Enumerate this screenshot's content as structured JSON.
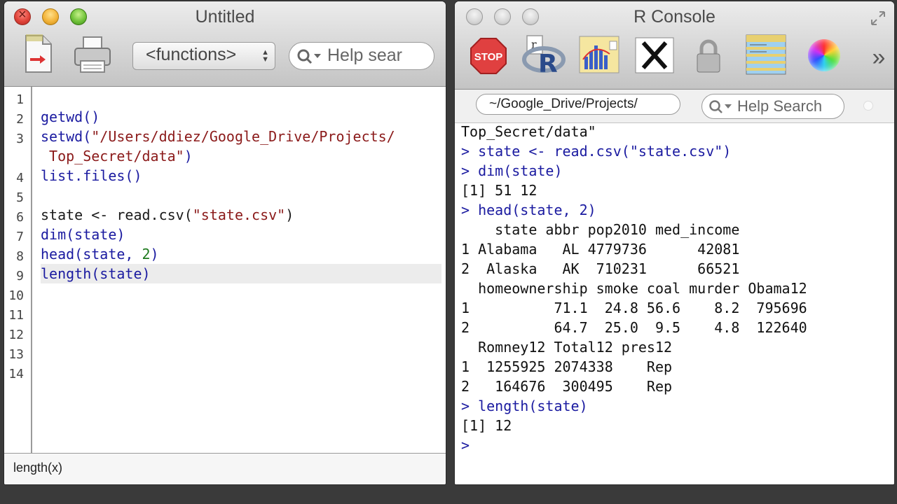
{
  "editor": {
    "title": "Untitled",
    "functions_popup": "<functions>",
    "search_placeholder": "Help sear",
    "lines": [
      {
        "num": "1",
        "code": ""
      },
      {
        "num": "2",
        "code": "getwd()"
      },
      {
        "num": "3",
        "code": "setwd(\"/Users/ddiez/Google_Drive/Projects/"
      },
      {
        "num": "",
        "code": " Top_Secret/data\")"
      },
      {
        "num": "4",
        "code": "list.files()"
      },
      {
        "num": "5",
        "code": ""
      },
      {
        "num": "6",
        "code": "state <- read.csv(\"state.csv\")"
      },
      {
        "num": "7",
        "code": "dim(state)"
      },
      {
        "num": "8",
        "code": "head(state, 2)"
      },
      {
        "num": "9",
        "code": "length(state)"
      },
      {
        "num": "10",
        "code": ""
      },
      {
        "num": "11",
        "code": ""
      },
      {
        "num": "12",
        "code": ""
      },
      {
        "num": "13",
        "code": ""
      },
      {
        "num": "14",
        "code": ""
      }
    ],
    "code_parts": {
      "setwd_fn": "setwd(",
      "setwd_path1": "\"/Users/ddiez/Google_Drive/Projects/",
      "setwd_path2": " Top_Secret/data\"",
      "close_paren": ")",
      "state_assign": "state <- read.csv(",
      "state_file": "\"state.csv\"",
      "head_fn": "head(state, ",
      "head_n": "2"
    },
    "status_hint": "length(x)"
  },
  "console": {
    "title": "R Console",
    "toolbar": {
      "stop_label": "STOP",
      "more_label": "»"
    },
    "working_dir": "~/Google_Drive/Projects/",
    "search_placeholder": "Help Search",
    "output": [
      {
        "text": "Top_Secret/data\"",
        "kind": "out"
      },
      {
        "text": "> state <- read.csv(\"state.csv\")",
        "kind": "cmd"
      },
      {
        "text": "> dim(state)",
        "kind": "cmd"
      },
      {
        "text": "[1] 51 12",
        "kind": "out"
      },
      {
        "text": "> head(state, 2)",
        "kind": "cmd"
      },
      {
        "text": "    state abbr pop2010 med_income",
        "kind": "out"
      },
      {
        "text": "1 Alabama   AL 4779736      42081",
        "kind": "out"
      },
      {
        "text": "2  Alaska   AK  710231      66521",
        "kind": "out"
      },
      {
        "text": "  homeownership smoke coal murder Obama12",
        "kind": "out"
      },
      {
        "text": "1          71.1  24.8 56.6    8.2  795696",
        "kind": "out"
      },
      {
        "text": "2          64.7  25.0  9.5    4.8  122640",
        "kind": "out"
      },
      {
        "text": "  Romney12 Total12 pres12",
        "kind": "out"
      },
      {
        "text": "1  1255925 2074338    Rep",
        "kind": "out"
      },
      {
        "text": "2   164676  300495    Rep",
        "kind": "out"
      },
      {
        "text": "> length(state)",
        "kind": "cmd"
      },
      {
        "text": "[1] 12",
        "kind": "out"
      },
      {
        "text": ">",
        "kind": "cmd"
      }
    ]
  },
  "icons": {
    "editor_toolbar": [
      "new-document-icon",
      "print-icon",
      "search-icon"
    ],
    "console_toolbar": [
      "stop-icon",
      "r-source-icon",
      "quartz-chart-icon",
      "x11-icon",
      "lock-icon",
      "data-table-icon",
      "color-wheel-icon",
      "more-icon"
    ]
  },
  "colors": {
    "command": "#1a1aa0",
    "string": "#8b1a1a",
    "number": "#1e7a1e",
    "output": "#111111"
  }
}
